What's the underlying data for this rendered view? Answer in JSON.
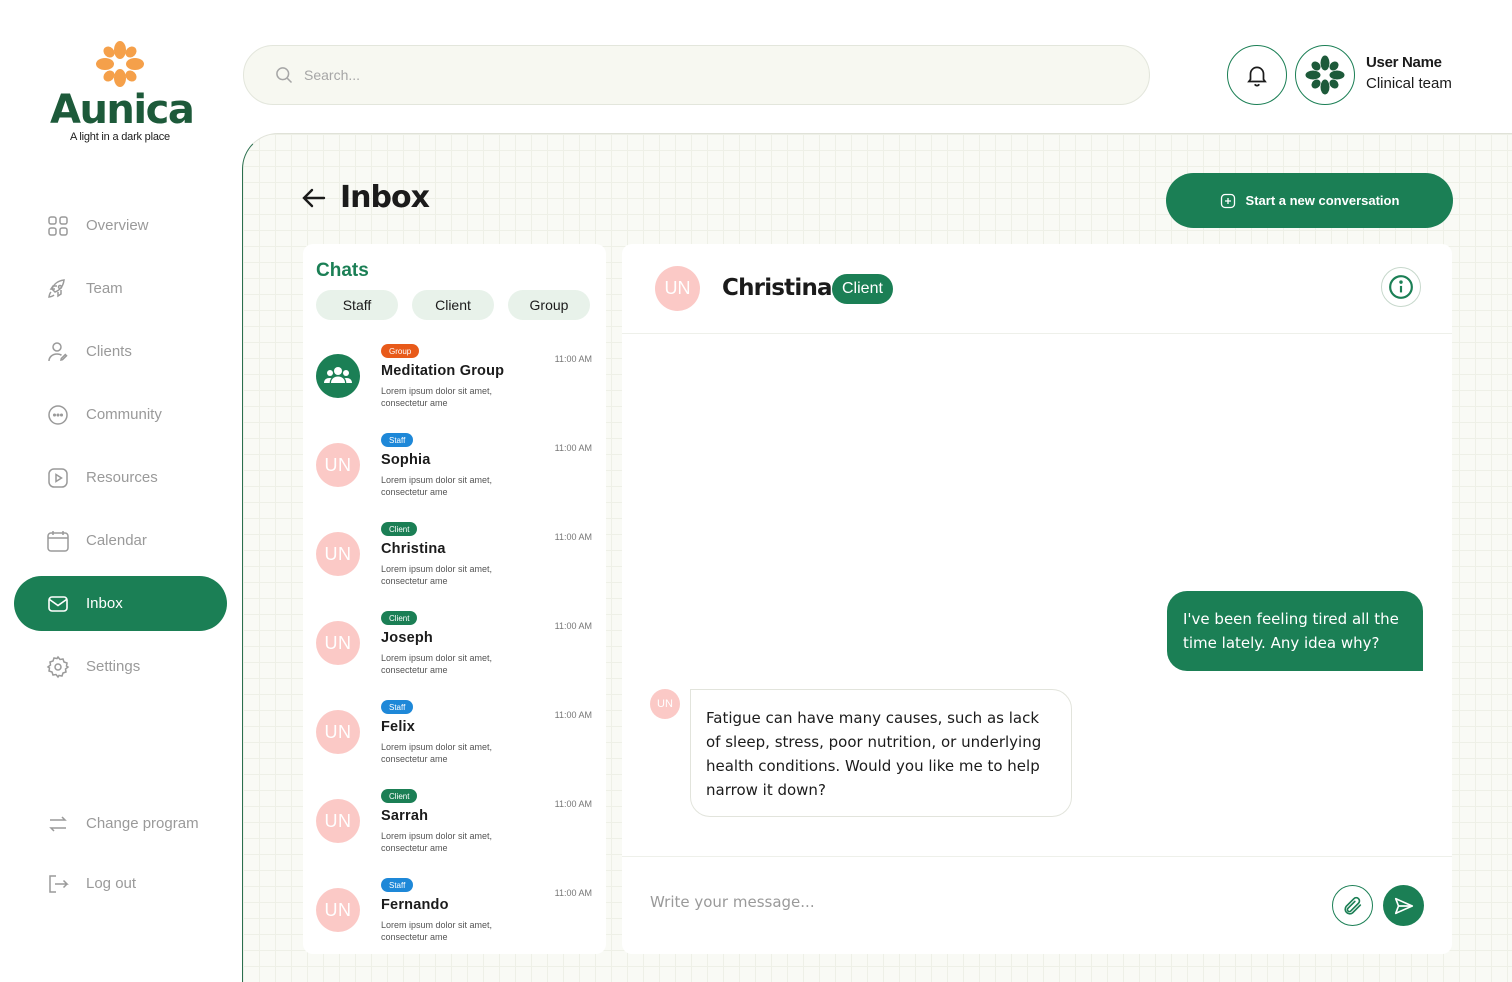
{
  "brand": {
    "name": "Aunica",
    "tagline": "A light in a dark place",
    "colors": {
      "primary": "#1b7f55",
      "logo_orange": "#f5a04a",
      "logo_dark": "#1d5a3a"
    }
  },
  "sidebar": {
    "items": [
      {
        "label": "Overview",
        "icon": "grid-icon"
      },
      {
        "label": "Team",
        "icon": "rocket-icon"
      },
      {
        "label": "Clients",
        "icon": "user-icon"
      },
      {
        "label": "Community",
        "icon": "chat-bubble-icon"
      },
      {
        "label": "Resources",
        "icon": "play-icon"
      },
      {
        "label": "Calendar",
        "icon": "calendar-icon"
      },
      {
        "label": "Inbox",
        "icon": "mail-icon",
        "active": true
      },
      {
        "label": "Settings",
        "icon": "gear-icon"
      }
    ],
    "bottom": [
      {
        "label": "Change program",
        "icon": "swap-icon"
      },
      {
        "label": "Log out",
        "icon": "logout-icon"
      }
    ]
  },
  "search": {
    "placeholder": "Search..."
  },
  "user": {
    "name": "User Name",
    "role": "Clinical team"
  },
  "page": {
    "title": "Inbox",
    "new_conversation_label": "Start a new conversation"
  },
  "chats": {
    "title": "Chats",
    "filters": [
      "Staff",
      "Client",
      "Group"
    ],
    "items": [
      {
        "badge": "Group",
        "name": "Meditation Group",
        "preview": "Lorem ipsum dolor sit amet, consectetur ame",
        "time": "11:00 AM",
        "avatar": ""
      },
      {
        "badge": "Staff",
        "name": "Sophia",
        "preview": "Lorem ipsum dolor sit amet, consectetur ame",
        "time": "11:00 AM",
        "avatar": "UN"
      },
      {
        "badge": "Client",
        "name": "Christina",
        "preview": "Lorem ipsum dolor sit amet, consectetur ame",
        "time": "11:00 AM",
        "avatar": "UN"
      },
      {
        "badge": "Client",
        "name": "Joseph",
        "preview": "Lorem ipsum dolor sit amet, consectetur ame",
        "time": "11:00 AM",
        "avatar": "UN"
      },
      {
        "badge": "Staff",
        "name": "Felix",
        "preview": "Lorem ipsum dolor sit amet, consectetur ame",
        "time": "11:00 AM",
        "avatar": "UN"
      },
      {
        "badge": "Client",
        "name": "Sarrah",
        "preview": "Lorem ipsum dolor sit amet, consectetur ame",
        "time": "11:00 AM",
        "avatar": "UN"
      },
      {
        "badge": "Staff",
        "name": "Fernando",
        "preview": "Lorem ipsum dolor sit amet, consectetur ame",
        "time": "11:00 AM",
        "avatar": "UN"
      }
    ]
  },
  "conversation": {
    "avatar": "UN",
    "name": "Christina",
    "tag": "Client",
    "messages": {
      "outgoing": "I've been feeling tired all the time lately. Any idea why?",
      "incoming_avatar": "UN",
      "incoming": "Fatigue can have many causes, such as lack of sleep, stress, poor nutrition, or underlying health conditions. Would you like me to help narrow it down?"
    },
    "composer_placeholder": "Write your message..."
  }
}
